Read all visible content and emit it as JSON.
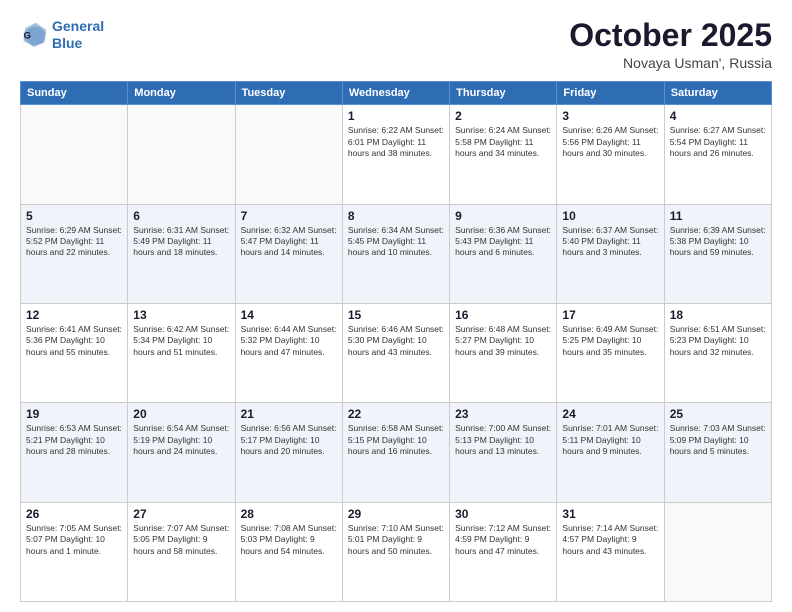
{
  "header": {
    "logo_line1": "General",
    "logo_line2": "Blue",
    "month": "October 2025",
    "location": "Novaya Usman', Russia"
  },
  "weekdays": [
    "Sunday",
    "Monday",
    "Tuesday",
    "Wednesday",
    "Thursday",
    "Friday",
    "Saturday"
  ],
  "weeks": [
    [
      {
        "day": "",
        "info": ""
      },
      {
        "day": "",
        "info": ""
      },
      {
        "day": "",
        "info": ""
      },
      {
        "day": "1",
        "info": "Sunrise: 6:22 AM\nSunset: 6:01 PM\nDaylight: 11 hours\nand 38 minutes."
      },
      {
        "day": "2",
        "info": "Sunrise: 6:24 AM\nSunset: 5:58 PM\nDaylight: 11 hours\nand 34 minutes."
      },
      {
        "day": "3",
        "info": "Sunrise: 6:26 AM\nSunset: 5:56 PM\nDaylight: 11 hours\nand 30 minutes."
      },
      {
        "day": "4",
        "info": "Sunrise: 6:27 AM\nSunset: 5:54 PM\nDaylight: 11 hours\nand 26 minutes."
      }
    ],
    [
      {
        "day": "5",
        "info": "Sunrise: 6:29 AM\nSunset: 5:52 PM\nDaylight: 11 hours\nand 22 minutes."
      },
      {
        "day": "6",
        "info": "Sunrise: 6:31 AM\nSunset: 5:49 PM\nDaylight: 11 hours\nand 18 minutes."
      },
      {
        "day": "7",
        "info": "Sunrise: 6:32 AM\nSunset: 5:47 PM\nDaylight: 11 hours\nand 14 minutes."
      },
      {
        "day": "8",
        "info": "Sunrise: 6:34 AM\nSunset: 5:45 PM\nDaylight: 11 hours\nand 10 minutes."
      },
      {
        "day": "9",
        "info": "Sunrise: 6:36 AM\nSunset: 5:43 PM\nDaylight: 11 hours\nand 6 minutes."
      },
      {
        "day": "10",
        "info": "Sunrise: 6:37 AM\nSunset: 5:40 PM\nDaylight: 11 hours\nand 3 minutes."
      },
      {
        "day": "11",
        "info": "Sunrise: 6:39 AM\nSunset: 5:38 PM\nDaylight: 10 hours\nand 59 minutes."
      }
    ],
    [
      {
        "day": "12",
        "info": "Sunrise: 6:41 AM\nSunset: 5:36 PM\nDaylight: 10 hours\nand 55 minutes."
      },
      {
        "day": "13",
        "info": "Sunrise: 6:42 AM\nSunset: 5:34 PM\nDaylight: 10 hours\nand 51 minutes."
      },
      {
        "day": "14",
        "info": "Sunrise: 6:44 AM\nSunset: 5:32 PM\nDaylight: 10 hours\nand 47 minutes."
      },
      {
        "day": "15",
        "info": "Sunrise: 6:46 AM\nSunset: 5:30 PM\nDaylight: 10 hours\nand 43 minutes."
      },
      {
        "day": "16",
        "info": "Sunrise: 6:48 AM\nSunset: 5:27 PM\nDaylight: 10 hours\nand 39 minutes."
      },
      {
        "day": "17",
        "info": "Sunrise: 6:49 AM\nSunset: 5:25 PM\nDaylight: 10 hours\nand 35 minutes."
      },
      {
        "day": "18",
        "info": "Sunrise: 6:51 AM\nSunset: 5:23 PM\nDaylight: 10 hours\nand 32 minutes."
      }
    ],
    [
      {
        "day": "19",
        "info": "Sunrise: 6:53 AM\nSunset: 5:21 PM\nDaylight: 10 hours\nand 28 minutes."
      },
      {
        "day": "20",
        "info": "Sunrise: 6:54 AM\nSunset: 5:19 PM\nDaylight: 10 hours\nand 24 minutes."
      },
      {
        "day": "21",
        "info": "Sunrise: 6:56 AM\nSunset: 5:17 PM\nDaylight: 10 hours\nand 20 minutes."
      },
      {
        "day": "22",
        "info": "Sunrise: 6:58 AM\nSunset: 5:15 PM\nDaylight: 10 hours\nand 16 minutes."
      },
      {
        "day": "23",
        "info": "Sunrise: 7:00 AM\nSunset: 5:13 PM\nDaylight: 10 hours\nand 13 minutes."
      },
      {
        "day": "24",
        "info": "Sunrise: 7:01 AM\nSunset: 5:11 PM\nDaylight: 10 hours\nand 9 minutes."
      },
      {
        "day": "25",
        "info": "Sunrise: 7:03 AM\nSunset: 5:09 PM\nDaylight: 10 hours\nand 5 minutes."
      }
    ],
    [
      {
        "day": "26",
        "info": "Sunrise: 7:05 AM\nSunset: 5:07 PM\nDaylight: 10 hours\nand 1 minute."
      },
      {
        "day": "27",
        "info": "Sunrise: 7:07 AM\nSunset: 5:05 PM\nDaylight: 9 hours\nand 58 minutes."
      },
      {
        "day": "28",
        "info": "Sunrise: 7:08 AM\nSunset: 5:03 PM\nDaylight: 9 hours\nand 54 minutes."
      },
      {
        "day": "29",
        "info": "Sunrise: 7:10 AM\nSunset: 5:01 PM\nDaylight: 9 hours\nand 50 minutes."
      },
      {
        "day": "30",
        "info": "Sunrise: 7:12 AM\nSunset: 4:59 PM\nDaylight: 9 hours\nand 47 minutes."
      },
      {
        "day": "31",
        "info": "Sunrise: 7:14 AM\nSunset: 4:57 PM\nDaylight: 9 hours\nand 43 minutes."
      },
      {
        "day": "",
        "info": ""
      }
    ]
  ]
}
